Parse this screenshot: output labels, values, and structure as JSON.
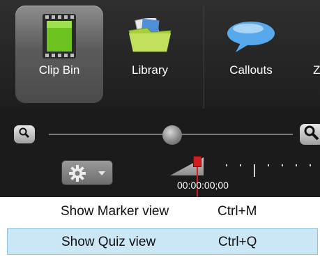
{
  "toolbar": {
    "items": [
      {
        "label": "Clip Bin",
        "icon": "film-clip-icon",
        "active": true
      },
      {
        "label": "Library",
        "icon": "library-folder-icon",
        "active": false
      },
      {
        "label": "Callouts",
        "icon": "speech-bubble-icon",
        "active": false
      },
      {
        "label": "Z",
        "icon": "",
        "active": false
      }
    ]
  },
  "zoom": {
    "zoom_out_icon": "zoom-out-magnifier-icon",
    "zoom_in_icon": "zoom-in-magnifier-icon",
    "level": 0.49
  },
  "timeline": {
    "settings_icon": "gear-icon",
    "dropdown_icon": "chevron-down-icon",
    "timecode": "00:00:00;00",
    "colors": {
      "playhead": "#d01e1e"
    }
  },
  "menu": {
    "items": [
      {
        "label": "Show Marker view",
        "shortcut": "Ctrl+M",
        "highlighted": false
      },
      {
        "label": "Show Quiz view",
        "shortcut": "Ctrl+Q",
        "highlighted": true
      }
    ],
    "colors": {
      "highlight": "#cbe6f5",
      "highlight_border": "#8cc4e4"
    }
  }
}
